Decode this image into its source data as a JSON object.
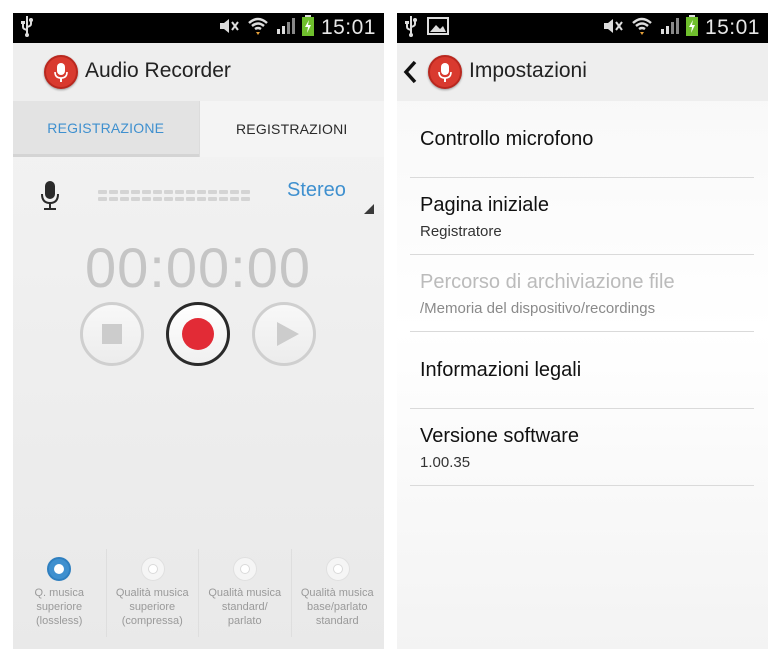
{
  "left_screen": {
    "status_bar": {
      "time": "15:01",
      "icons": [
        "usb-icon",
        "mute-icon",
        "wifi-icon",
        "signal-icon",
        "battery-charging-icon"
      ]
    },
    "app_title": "Audio Recorder",
    "tabs": [
      {
        "label": "REGISTRAZIONE",
        "active": true
      },
      {
        "label": "REGISTRAZIONI",
        "active": false
      }
    ],
    "channel_mode": "Stereo",
    "timer": "00:00:00",
    "controls": [
      "stop-icon",
      "record-icon",
      "play-icon"
    ],
    "quality_options": [
      {
        "lines": [
          "Q. musica",
          "superiore",
          "(lossless)"
        ],
        "selected": true
      },
      {
        "lines": [
          "Qualità musica",
          "superiore",
          "(compressa)"
        ],
        "selected": false
      },
      {
        "lines": [
          "Qualità musica",
          "standard/",
          "parlato"
        ],
        "selected": false
      },
      {
        "lines": [
          "Qualità musica",
          "base/parlato",
          "standard"
        ],
        "selected": false
      }
    ]
  },
  "right_screen": {
    "status_bar": {
      "time": "15:01",
      "icons": [
        "usb-icon",
        "image-icon",
        "mute-icon",
        "wifi-icon",
        "signal-icon",
        "battery-charging-icon"
      ]
    },
    "title": "Impostazioni",
    "settings": [
      {
        "title": "Controllo microfono",
        "subtitle": "",
        "enabled": true
      },
      {
        "title": "Pagina iniziale",
        "subtitle": "Registratore",
        "enabled": true
      },
      {
        "title": "Percorso di archiviazione file",
        "subtitle": "/Memoria del dispositivo/recordings",
        "enabled": false
      },
      {
        "title": "Informazioni legali",
        "subtitle": "",
        "enabled": true
      },
      {
        "title": "Versione software",
        "subtitle": "1.00.35",
        "enabled": true
      }
    ]
  },
  "colors": {
    "accent": "#3f90cf",
    "record_red": "#e22b36",
    "app_icon_red": "#d93a2f"
  }
}
